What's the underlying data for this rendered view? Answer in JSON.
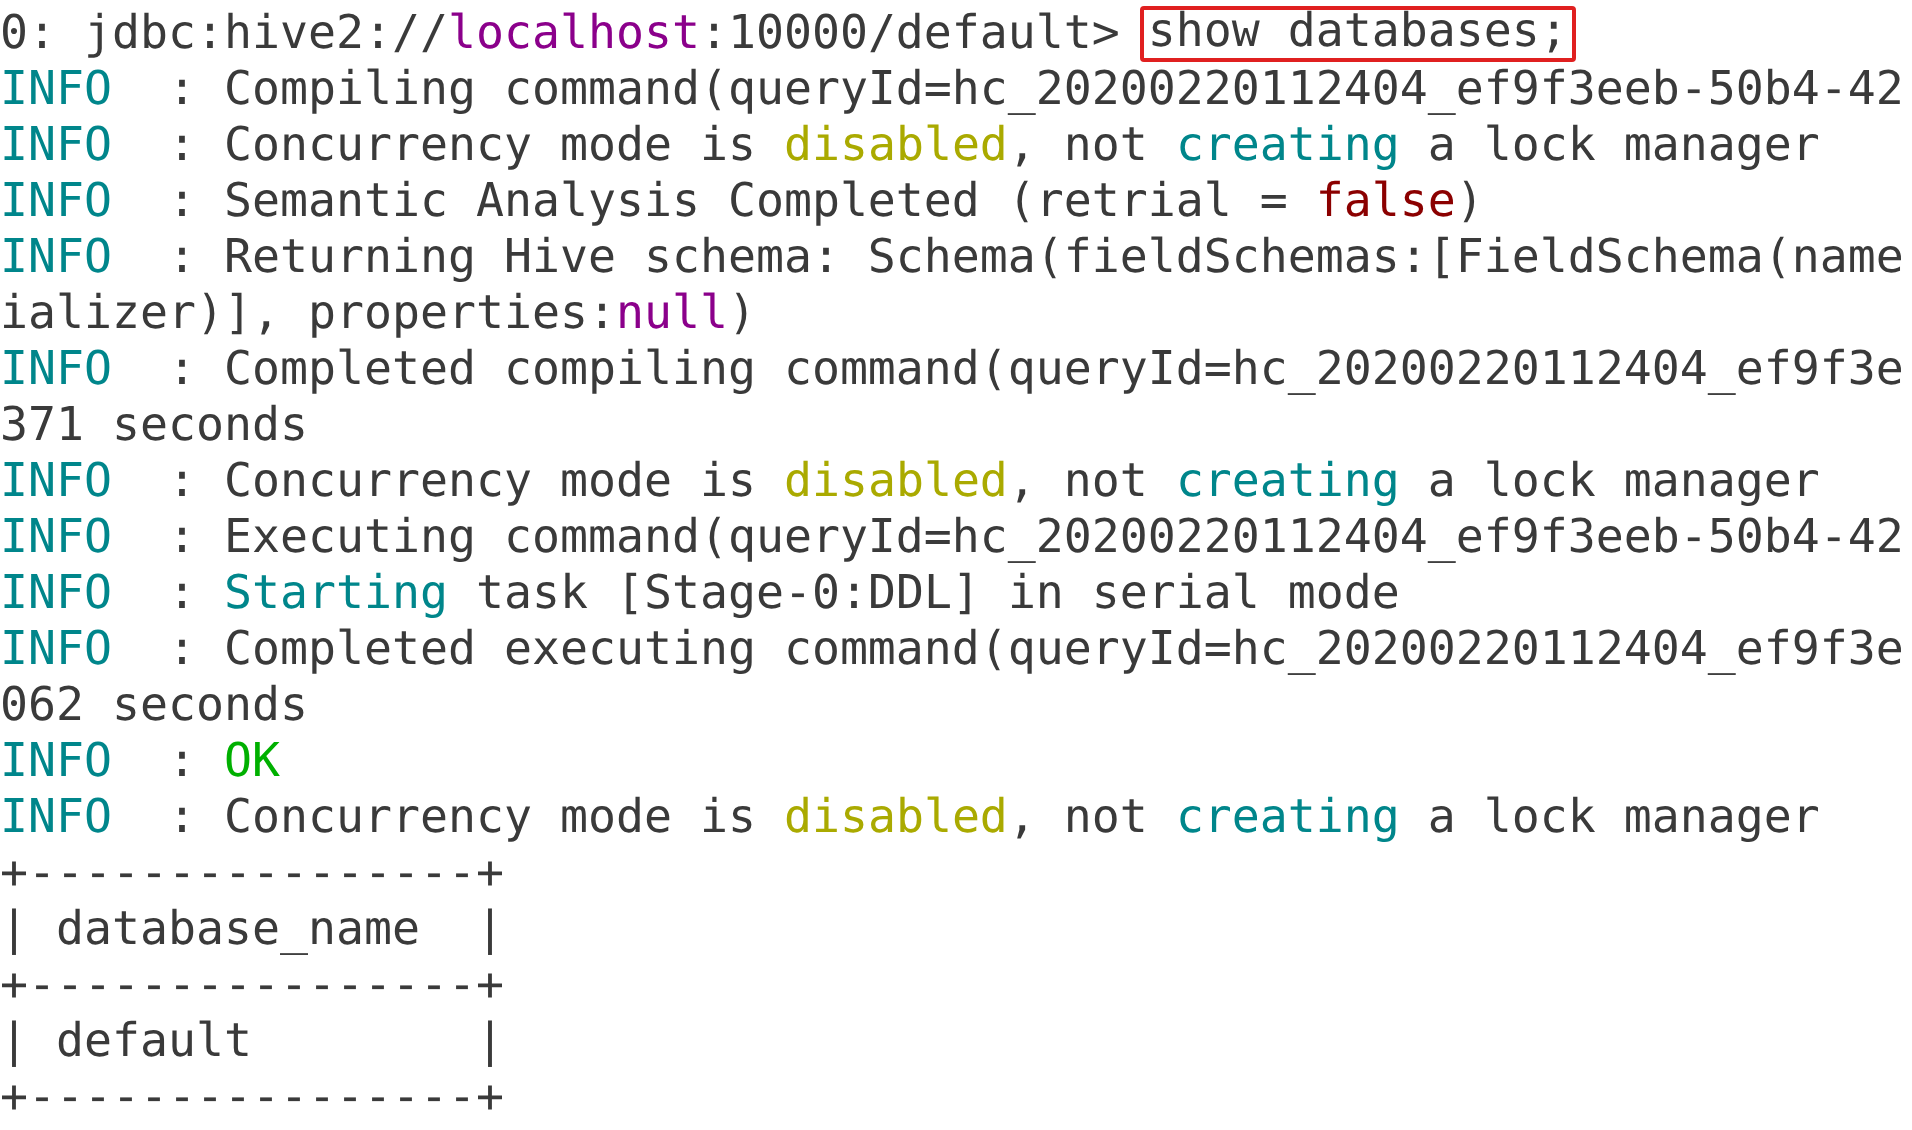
{
  "terminal": {
    "prompt": [
      {
        "text": "0: jdbc:hive2://"
      },
      {
        "text": "localhost",
        "color": "#8b008b"
      },
      {
        "text": ":10000/default> "
      }
    ],
    "command": {
      "text": "show databases;",
      "highlighted": true
    },
    "lines": [
      [
        {
          "text": "INFO",
          "color": "#00868b"
        },
        {
          "text": "  : Compiling command(queryId=hc_20200220112404_ef9f3eeb-50b4-42"
        }
      ],
      [
        {
          "text": "INFO",
          "color": "#00868b"
        },
        {
          "text": "  : Concurrency mode is "
        },
        {
          "text": "disabled",
          "color": "#aaaa00"
        },
        {
          "text": ", not "
        },
        {
          "text": "creating",
          "color": "#00868b"
        },
        {
          "text": " a lock manager"
        }
      ],
      [
        {
          "text": "INFO",
          "color": "#00868b"
        },
        {
          "text": "  : Semantic Analysis Completed (retrial = "
        },
        {
          "text": "false",
          "color": "#8b0000"
        },
        {
          "text": ")"
        }
      ],
      [
        {
          "text": "INFO",
          "color": "#00868b"
        },
        {
          "text": "  : Returning Hive schema: Schema(fieldSchemas:[FieldSchema(name"
        }
      ],
      [
        {
          "text": "ializer)], properties:"
        },
        {
          "text": "null",
          "color": "#8b008b"
        },
        {
          "text": ")"
        }
      ],
      [
        {
          "text": "INFO",
          "color": "#00868b"
        },
        {
          "text": "  : Completed compiling command(queryId=hc_20200220112404_ef9f3e"
        }
      ],
      [
        {
          "text": "371 seconds"
        }
      ],
      [
        {
          "text": "INFO",
          "color": "#00868b"
        },
        {
          "text": "  : Concurrency mode is "
        },
        {
          "text": "disabled",
          "color": "#aaaa00"
        },
        {
          "text": ", not "
        },
        {
          "text": "creating",
          "color": "#00868b"
        },
        {
          "text": " a lock manager"
        }
      ],
      [
        {
          "text": "INFO",
          "color": "#00868b"
        },
        {
          "text": "  : Executing command(queryId=hc_20200220112404_ef9f3eeb-50b4-42"
        }
      ],
      [
        {
          "text": "INFO",
          "color": "#00868b"
        },
        {
          "text": "  : "
        },
        {
          "text": "Starting",
          "color": "#00868b"
        },
        {
          "text": " task [Stage-0:DDL] in serial mode"
        }
      ],
      [
        {
          "text": "INFO",
          "color": "#00868b"
        },
        {
          "text": "  : Completed executing command(queryId=hc_20200220112404_ef9f3e"
        }
      ],
      [
        {
          "text": "062 seconds"
        }
      ],
      [
        {
          "text": "INFO",
          "color": "#00868b"
        },
        {
          "text": "  : "
        },
        {
          "text": "OK",
          "color": "#00b000"
        }
      ],
      [
        {
          "text": "INFO",
          "color": "#00868b"
        },
        {
          "text": "  : Concurrency mode is "
        },
        {
          "text": "disabled",
          "color": "#aaaa00"
        },
        {
          "text": ", not "
        },
        {
          "text": "creating",
          "color": "#00868b"
        },
        {
          "text": " a lock manager"
        }
      ],
      [
        {
          "text": "+----------------+"
        }
      ],
      [
        {
          "text": "| database_name  |"
        }
      ],
      [
        {
          "text": "+----------------+"
        }
      ],
      [
        {
          "text": "| default        |"
        }
      ],
      [
        {
          "text": "+----------------+"
        }
      ]
    ]
  }
}
